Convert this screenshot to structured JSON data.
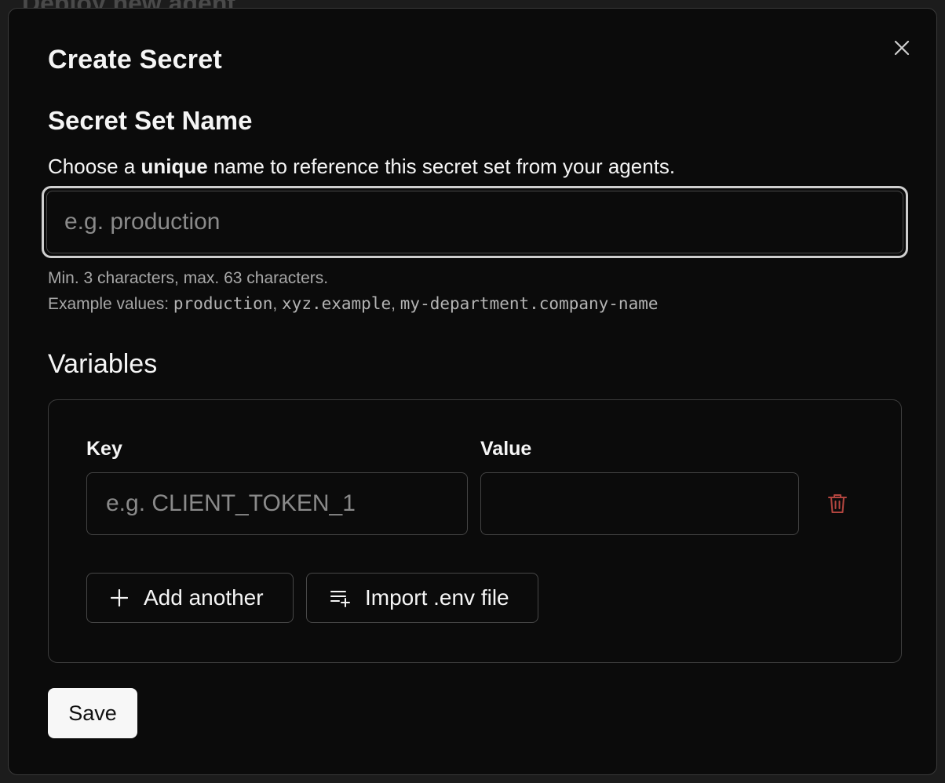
{
  "background": {
    "title": "Deploy new agent"
  },
  "modal": {
    "title": "Create Secret",
    "secret_set": {
      "heading": "Secret Set Name",
      "description_before": "Choose a ",
      "description_bold": "unique",
      "description_after": " name to reference this secret set from your agents.",
      "input_value": "",
      "input_placeholder": "e.g. production",
      "hint_length": "Min. 3 characters, max. 63 characters.",
      "hint_examples_prefix": "Example values: ",
      "example_1": "production",
      "example_2": "xyz.example",
      "example_3": "my-department.company-name",
      "separator": ", "
    },
    "variables": {
      "heading": "Variables",
      "key_label": "Key",
      "value_label": "Value",
      "rows": [
        {
          "key": "",
          "key_placeholder": "e.g. CLIENT_TOKEN_1",
          "value": "",
          "value_placeholder": ""
        }
      ],
      "add_another_label": "Add another",
      "import_label": "Import .env file"
    },
    "save_label": "Save"
  },
  "icons": {
    "close": "close-icon",
    "trash": "trash-icon",
    "plus": "plus-icon",
    "import": "playlist-add-icon"
  },
  "colors": {
    "modal_background": "#0b0b0b",
    "trash_icon": "#b2453f",
    "save_button_background": "#f7f7f7"
  }
}
